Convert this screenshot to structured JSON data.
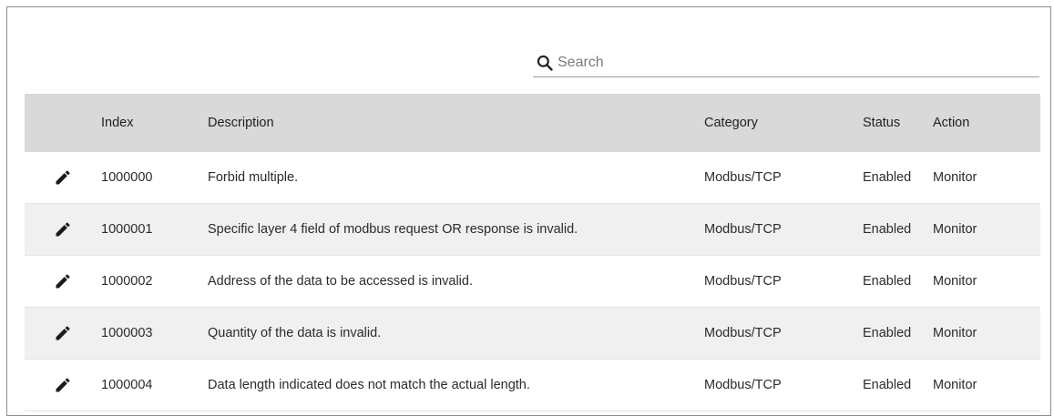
{
  "search": {
    "placeholder": "Search",
    "value": ""
  },
  "table": {
    "headers": {
      "edit": "",
      "index": "Index",
      "description": "Description",
      "category": "Category",
      "status": "Status",
      "action": "Action"
    },
    "rows": [
      {
        "index": "1000000",
        "description": "Forbid multiple.",
        "category": "Modbus/TCP",
        "status": "Enabled",
        "action": "Monitor"
      },
      {
        "index": "1000001",
        "description": "Specific layer 4 field of modbus request OR response is invalid.",
        "category": "Modbus/TCP",
        "status": "Enabled",
        "action": "Monitor"
      },
      {
        "index": "1000002",
        "description": "Address of the data to be accessed is invalid.",
        "category": "Modbus/TCP",
        "status": "Enabled",
        "action": "Monitor"
      },
      {
        "index": "1000003",
        "description": "Quantity of the data is invalid.",
        "category": "Modbus/TCP",
        "status": "Enabled",
        "action": "Monitor"
      },
      {
        "index": "1000004",
        "description": "Data length indicated does not match the actual length.",
        "category": "Modbus/TCP",
        "status": "Enabled",
        "action": "Monitor"
      }
    ]
  },
  "icons": {
    "search": "search-icon",
    "edit": "pencil-icon"
  },
  "colors": {
    "header_bg": "#d9d9d9",
    "stripe_bg": "#f0f0f0",
    "border": "#8c8c8c"
  }
}
